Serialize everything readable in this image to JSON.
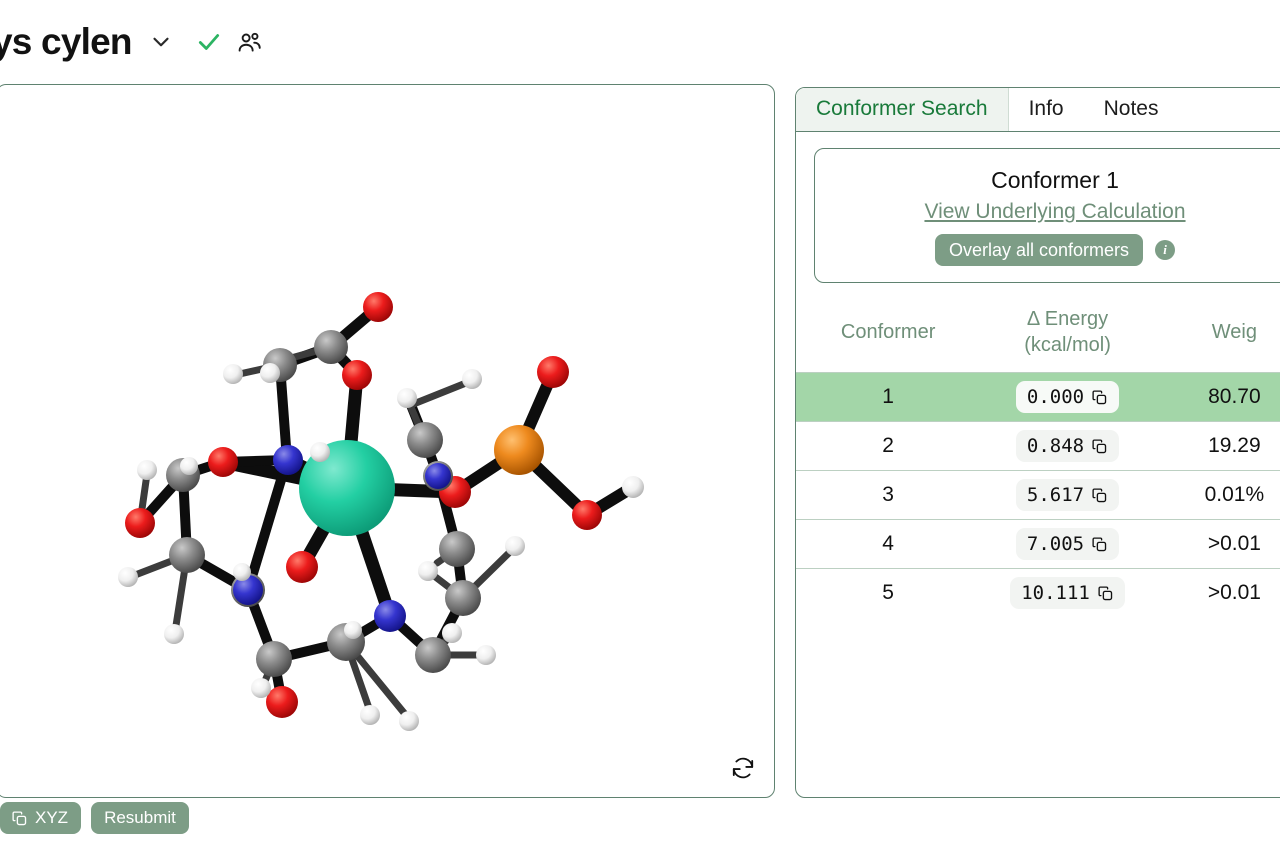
{
  "header": {
    "title": "ys cylen",
    "dropdown_icon": "chevron-down-icon",
    "status_icon": "check-icon",
    "status_color": "#2cb463",
    "share_icon": "people-icon"
  },
  "viewer": {
    "refresh_icon": "refresh-icon",
    "molecule": {
      "description": "3D ball-and-stick model of a metal complex",
      "atom_colors": {
        "metal": "#23cfa3",
        "oxygen": "#e81313",
        "nitrogen": "#3333cc",
        "carbon": "#8a8a8a",
        "hydrogen": "#f2f2f2",
        "phosphorus": "#ef8b22"
      }
    }
  },
  "bottom_bar": {
    "xyz_label": "XYZ",
    "xyz_icon": "copy-icon",
    "resubmit_label": "Resubmit"
  },
  "right_panel": {
    "tabs": [
      {
        "label": "Conformer Search",
        "active": true
      },
      {
        "label": "Info",
        "active": false
      },
      {
        "label": "Notes",
        "active": false
      }
    ],
    "conformer_card": {
      "title": "Conformer 1",
      "link_label": "View Underlying Calculation",
      "overlay_button_label": "Overlay all conformers",
      "info_icon": "info-icon",
      "info_glyph": "i"
    },
    "table": {
      "headers": {
        "conformer": "Conformer",
        "energy_line1": "Δ Energy",
        "energy_line2": "(kcal/mol)",
        "weight": "Weig"
      },
      "rows": [
        {
          "conformer": "1",
          "energy": "0.000",
          "weight": "80.70",
          "copy_icon": "copy-icon",
          "selected": true
        },
        {
          "conformer": "2",
          "energy": "0.848",
          "weight": "19.29",
          "copy_icon": "copy-icon",
          "selected": false
        },
        {
          "conformer": "3",
          "energy": "5.617",
          "weight": "0.01%",
          "copy_icon": "copy-icon",
          "selected": false
        },
        {
          "conformer": "4",
          "energy": "7.005",
          "weight": ">0.01",
          "copy_icon": "copy-icon",
          "selected": false
        },
        {
          "conformer": "5",
          "energy": "10.111",
          "weight": ">0.01",
          "copy_icon": "copy-icon",
          "selected": false
        }
      ]
    }
  },
  "colors": {
    "accent_green": "#197a3a",
    "button_green": "#7d9d86",
    "row_highlight": "#a3d6a8",
    "panel_border": "#5f8270"
  }
}
